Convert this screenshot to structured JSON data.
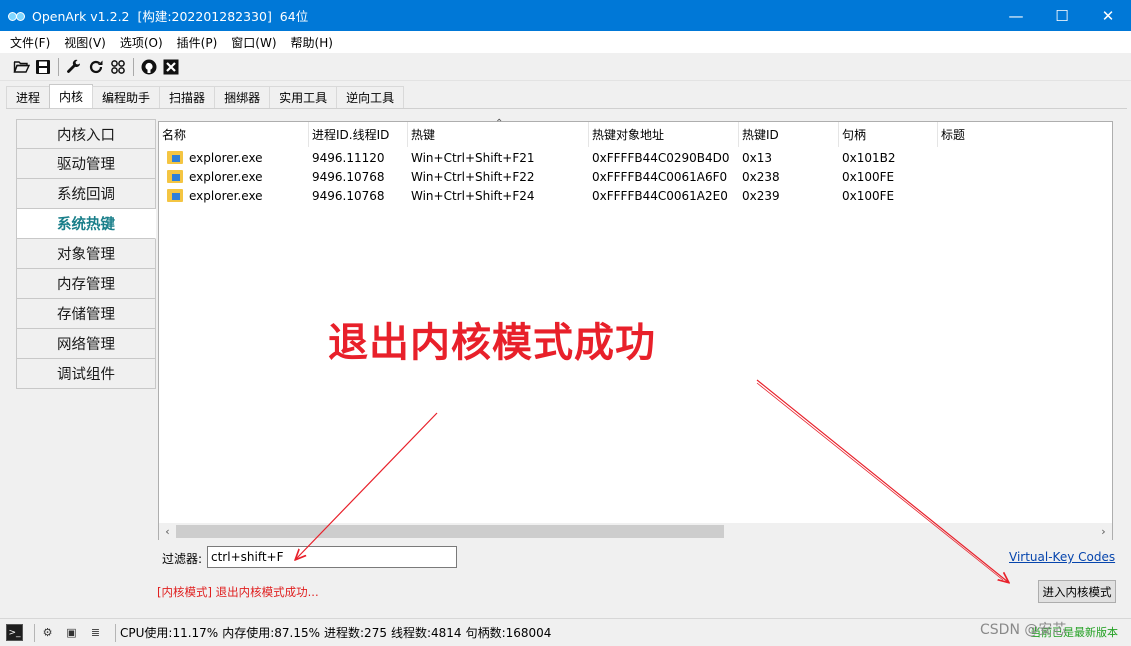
{
  "window": {
    "title": "OpenArk v1.2.2  [构建:202201282330]  64位",
    "minimize": "—",
    "maximize": "☐",
    "close": "✕"
  },
  "menu": [
    "文件(F)",
    "视图(V)",
    "选项(O)",
    "插件(P)",
    "窗口(W)",
    "帮助(H)"
  ],
  "toolbar": {
    "icons": [
      "open-folder-icon",
      "save-icon",
      "wrench-icon",
      "refresh-icon",
      "grid-icon",
      "github-icon",
      "close-box-icon"
    ]
  },
  "tabs": [
    "进程",
    "内核",
    "编程助手",
    "扫描器",
    "捆绑器",
    "实用工具",
    "逆向工具"
  ],
  "active_tab": "内核",
  "sidebar": {
    "items": [
      "内核入口",
      "驱动管理",
      "系统回调",
      "系统热键",
      "对象管理",
      "内存管理",
      "存储管理",
      "网络管理",
      "调试组件"
    ],
    "active": "系统热键"
  },
  "table": {
    "columns": [
      "名称",
      "进程ID.线程ID",
      "热键",
      "热键对象地址",
      "热键ID",
      "句柄",
      "标题"
    ],
    "rows": [
      [
        "explorer.exe",
        "9496.11120",
        "Win+Ctrl+Shift+F21",
        "0xFFFFB44C0290B4D0",
        "0x13",
        "0x101B2",
        ""
      ],
      [
        "explorer.exe",
        "9496.10768",
        "Win+Ctrl+Shift+F22",
        "0xFFFFB44C0061A6F0",
        "0x238",
        "0x100FE",
        ""
      ],
      [
        "explorer.exe",
        "9496.10768",
        "Win+Ctrl+Shift+F24",
        "0xFFFFB44C0061A2E0",
        "0x239",
        "0x100FE",
        ""
      ]
    ]
  },
  "filter": {
    "label": "过滤器:",
    "value": "ctrl+shift+F"
  },
  "vk_link": "Virtual-Key Codes",
  "status_message": "[内核模式] 退出内核模式成功...",
  "enter_kernel_button": "进入内核模式",
  "annotation": "退出内核模式成功",
  "statusbar": {
    "cpu": "CPU使用:11.17%",
    "mem": "内存使用:87.15%",
    "procs": "进程数:275",
    "threads": "线程数:4814",
    "handles": "句柄数:168004",
    "watermark": "CSDN @安芯",
    "green_text": "当前已是最新版本"
  },
  "colors": {
    "titlebar": "#0078d7",
    "annotation_red": "#e8202a",
    "active_sidebar": "#1a7f8a",
    "link": "#0645ad"
  }
}
